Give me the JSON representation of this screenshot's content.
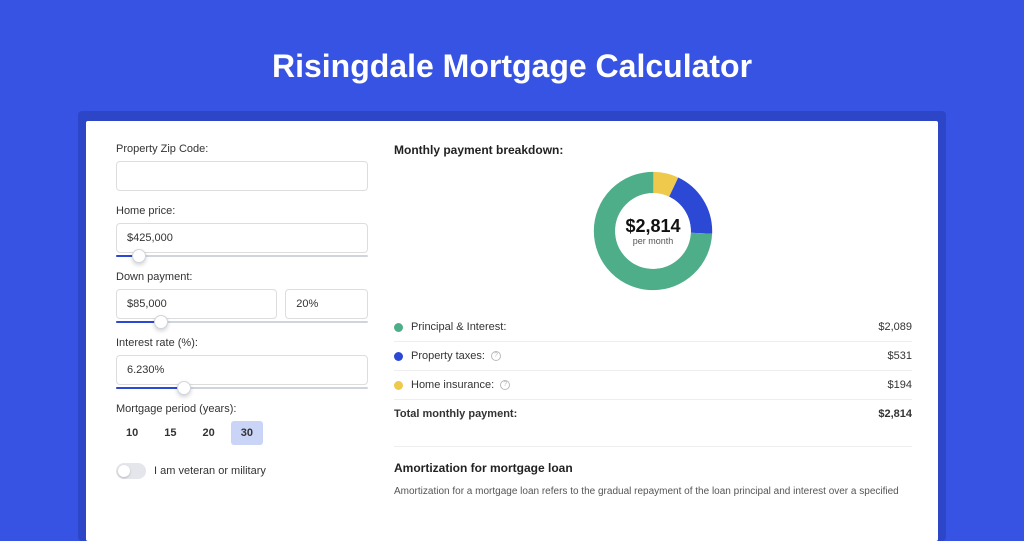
{
  "page": {
    "title": "Risingdale Mortgage Calculator"
  },
  "form": {
    "zip_label": "Property Zip Code:",
    "zip_value": "",
    "home_price_label": "Home price:",
    "home_price_value": "$425,000",
    "home_price_slider_pct": 9,
    "down_label": "Down payment:",
    "down_value": "$85,000",
    "down_pct_value": "20%",
    "down_slider_pct": 18,
    "rate_label": "Interest rate (%):",
    "rate_value": "6.230%",
    "rate_slider_pct": 27,
    "period_label": "Mortgage period (years):",
    "periods": [
      {
        "label": "10",
        "active": false
      },
      {
        "label": "15",
        "active": false
      },
      {
        "label": "20",
        "active": false
      },
      {
        "label": "30",
        "active": true
      }
    ],
    "veteran_label": "I am veteran or military",
    "veteran_on": false
  },
  "breakdown": {
    "title": "Monthly payment breakdown:",
    "center_amount": "$2,814",
    "center_sub": "per month",
    "rows": [
      {
        "color": "#4fae8a",
        "label": "Principal & Interest:",
        "info": false,
        "value": "$2,089"
      },
      {
        "color": "#2b49d4",
        "label": "Property taxes:",
        "info": true,
        "value": "$531"
      },
      {
        "color": "#efc94c",
        "label": "Home insurance:",
        "info": true,
        "value": "$194"
      }
    ],
    "total_label": "Total monthly payment:",
    "total_value": "$2,814"
  },
  "chart_data": {
    "type": "pie",
    "title": "Monthly payment breakdown",
    "series": [
      {
        "name": "Principal & Interest",
        "value": 2089,
        "color": "#4fae8a"
      },
      {
        "name": "Property taxes",
        "value": 531,
        "color": "#2b49d4"
      },
      {
        "name": "Home insurance",
        "value": 194,
        "color": "#efc94c"
      }
    ],
    "total": 2814,
    "unit": "USD per month"
  },
  "amort": {
    "title": "Amortization for mortgage loan",
    "text": "Amortization for a mortgage loan refers to the gradual repayment of the loan principal and interest over a specified"
  }
}
